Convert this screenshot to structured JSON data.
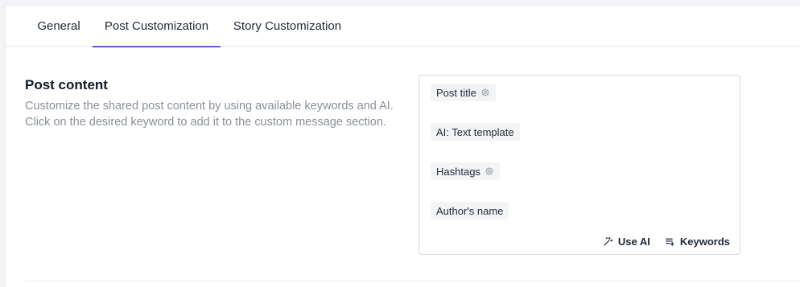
{
  "tabs": [
    {
      "label": "General",
      "active": false
    },
    {
      "label": "Post Customization",
      "active": true
    },
    {
      "label": "Story Customization",
      "active": false
    }
  ],
  "accent_color": "#6d5bd0",
  "post_content": {
    "title": "Post content",
    "description": "Customize the shared post content by using available keywords and AI. Click on the desired keyword to add it to the custom message section."
  },
  "editor": {
    "chips": [
      {
        "label": "Post title",
        "icon": "gear-icon"
      },
      {
        "label": "AI: Text template"
      },
      {
        "label": "Hashtags",
        "icon": "gear-icon"
      },
      {
        "label": "Author's name"
      }
    ],
    "actions": {
      "use_ai": {
        "label": "Use AI",
        "icon": "magic-wand-icon"
      },
      "keywords": {
        "label": "Keywords",
        "icon": "list-add-icon"
      }
    }
  }
}
